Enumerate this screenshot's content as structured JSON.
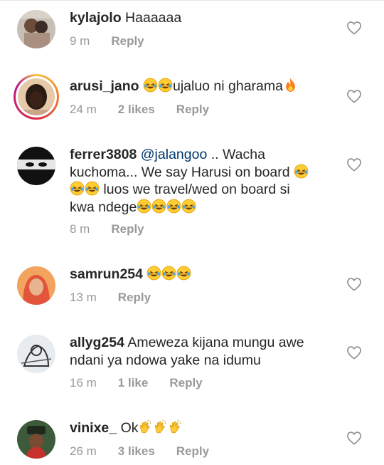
{
  "comments": [
    {
      "username": "kylajolo",
      "text": "Haaaaaa",
      "time": "9 m",
      "likes": "",
      "reply": "Reply"
    },
    {
      "username": "arusi_jano",
      "text": "ujaluo ni gharama",
      "emoji_before": [
        "laughing-tears",
        "laughing-tears"
      ],
      "emoji_after": [
        "fire"
      ],
      "time": "24 m",
      "likes": "2 likes",
      "reply": "Reply"
    },
    {
      "username": "ferrer3808",
      "mention": "@jalangoo",
      "text_line1": ".. Wacha",
      "text_line2": "kuchoma... We say Harusi on board",
      "text_line3": "luos we travel/wed on board si",
      "text_line4": "kwa ndege",
      "time": "8 m",
      "likes": "",
      "reply": "Reply"
    },
    {
      "username": "samrun254",
      "text": "",
      "time": "13 m",
      "likes": "",
      "reply": "Reply"
    },
    {
      "username": "allyg254",
      "text_line1": "Ameweza kijana mungu awe",
      "text_line2": "ndani ya ndowa yake na idumu",
      "time": "16 m",
      "likes": "1 like",
      "reply": "Reply"
    },
    {
      "username": "vinixe_",
      "text": "Ok",
      "time": "26 m",
      "likes": "3 likes",
      "reply": "Reply"
    }
  ],
  "icons": {
    "like": "heart-outline-icon",
    "laugh": "laughing-tears-emoji",
    "fire": "fire-emoji",
    "clap": "clapping-hands-emoji"
  },
  "colors": {
    "meta": "#999999",
    "mention": "#003569",
    "text": "#262626"
  }
}
